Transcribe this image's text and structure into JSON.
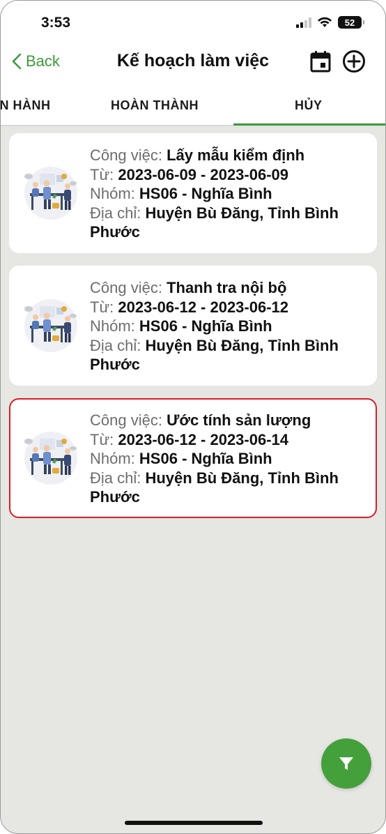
{
  "status_bar": {
    "time": "3:53",
    "battery": "52"
  },
  "nav": {
    "back_label": "Back",
    "title": "Kế hoạch làm việc"
  },
  "tabs": [
    {
      "label": "ẾN HÀNH",
      "active": false
    },
    {
      "label": "HOÀN THÀNH",
      "active": false
    },
    {
      "label": "HỦY",
      "active": true
    }
  ],
  "labels": {
    "task": "Công việc: ",
    "from": "Từ: ",
    "group": "Nhóm: ",
    "address": "Địa chỉ: "
  },
  "cards": [
    {
      "task": "Lấy mẫu kiểm định",
      "dates": "2023-06-09 - 2023-06-09",
      "group": "HS06 - Nghĩa Bình",
      "address": "Huyện Bù Đăng, Tỉnh Bình Phước",
      "selected": false
    },
    {
      "task": "Thanh tra nội bộ",
      "dates": "2023-06-12 - 2023-06-12",
      "group": "HS06 - Nghĩa Bình",
      "address": "Huyện Bù Đăng, Tỉnh Bình Phước",
      "selected": false
    },
    {
      "task": "Ước tính sản lượng",
      "dates": "2023-06-12 - 2023-06-14",
      "group": "HS06 - Nghĩa Bình",
      "address": "Huyện Bù Đăng, Tỉnh Bình Phước",
      "selected": true
    }
  ],
  "icons": {
    "back": "chevron-left-icon",
    "calendar": "calendar-icon",
    "add": "plus-circle-icon",
    "filter": "filter-icon",
    "card_illustration": "team-meeting-illustration"
  },
  "colors": {
    "accent": "#3d9a3a",
    "fab": "#44a03b",
    "selected_border": "#d81f26"
  }
}
